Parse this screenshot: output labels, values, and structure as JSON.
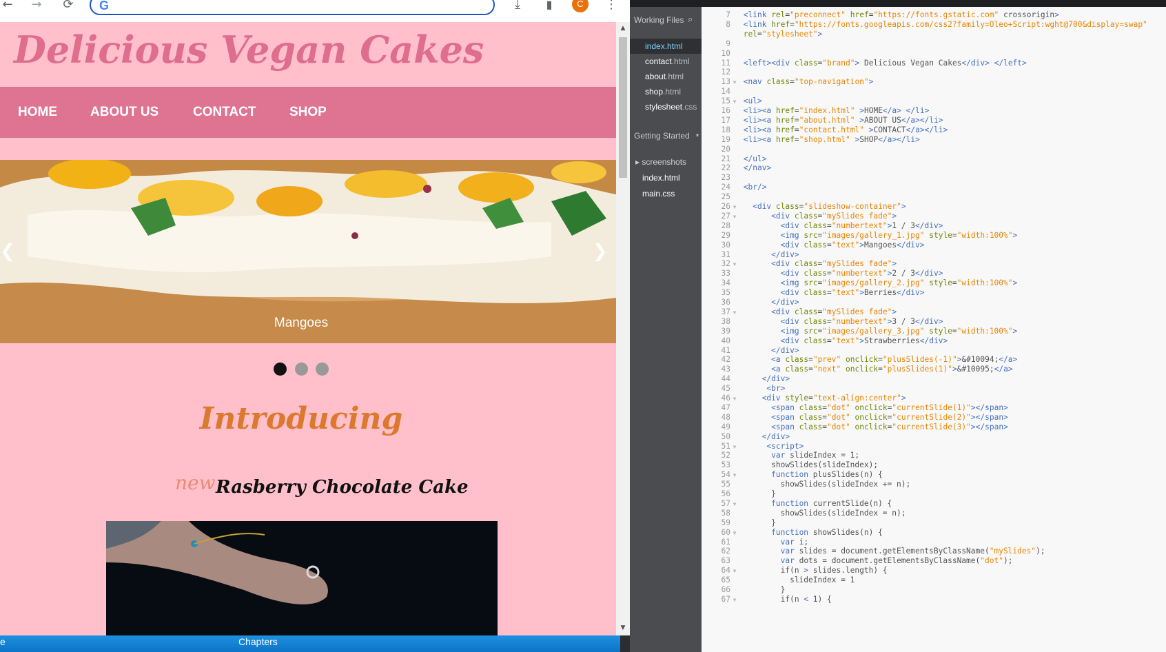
{
  "browser": {
    "toolbar": {
      "back": "←",
      "forward": "→",
      "reload": "⟳",
      "download": "⤓",
      "side_panel": "▮",
      "avatar_letter": "C",
      "menu": "⋮",
      "search_logo": "G"
    },
    "site": {
      "brand": "Delicious Vegan Cakes",
      "nav": [
        "HOME",
        "ABOUT US",
        "CONTACT",
        "SHOP"
      ],
      "slideshow": {
        "caption": "Mangoes",
        "prev": "❮",
        "next": "❯",
        "dots_count": 3,
        "active_dot": 1
      },
      "intro_heading": "Introducing",
      "new_tag": "new",
      "product_name": "Rasberry Chocolate Cake"
    },
    "colors": {
      "page_bg": "#ffc0cb",
      "nav_bg": "#df7392",
      "brand": "#df6d8e",
      "intro": "#db7a2f"
    }
  },
  "taskbar": {
    "left_text": "e",
    "chapters": "Chapters"
  },
  "editor": {
    "sidebar": {
      "working_files_label": "Working Files",
      "working_files": [
        {
          "name": "index",
          "ext": ".html",
          "selected": true
        },
        {
          "name": "contact",
          "ext": ".html",
          "selected": false
        },
        {
          "name": "about",
          "ext": ".html",
          "selected": false
        },
        {
          "name": "shop",
          "ext": ".html",
          "selected": false
        },
        {
          "name": "stylesheet",
          "ext": ".css",
          "selected": false
        }
      ],
      "project_label": "Getting Started",
      "project_items": [
        {
          "name": "screenshots",
          "folder": true
        },
        {
          "name": "index.html",
          "folder": false
        },
        {
          "name": "main.css",
          "folder": false
        }
      ]
    },
    "code_lines": [
      {
        "n": "7",
        "f": "",
        "t": "<link rel=\"preconnect\" href=\"https://fonts.gstatic.com\" crossorigin>"
      },
      {
        "n": "8",
        "f": "",
        "t": "<link href=\"https://fonts.googleapis.com/css2?family=Oleo+Script:wght@700&display=swap\""
      },
      {
        "n": "",
        "f": "",
        "t": "rel=\"stylesheet\">"
      },
      {
        "n": "9",
        "f": "",
        "t": ""
      },
      {
        "n": "10",
        "f": "",
        "t": ""
      },
      {
        "n": "11",
        "f": "",
        "t": "<left><div class=\"brand\"> Delicious Vegan Cakes</div> </left>"
      },
      {
        "n": "12",
        "f": "",
        "t": ""
      },
      {
        "n": "13",
        "f": "▼",
        "t": "<nav class=\"top-navigation\">"
      },
      {
        "n": "14",
        "f": "",
        "t": ""
      },
      {
        "n": "15",
        "f": "▼",
        "t": "<ul>"
      },
      {
        "n": "16",
        "f": "",
        "t": "<li><a href=\"index.html\" >HOME</a> </li>"
      },
      {
        "n": "17",
        "f": "",
        "t": "<li><a href=\"about.html\" >ABOUT US</a></li>"
      },
      {
        "n": "18",
        "f": "",
        "t": "<li><a href=\"contact.html\" >CONTACT</a></li>"
      },
      {
        "n": "19",
        "f": "",
        "t": "<li><a href=\"shop.html\" >SHOP</a></li>"
      },
      {
        "n": "20",
        "f": "",
        "t": ""
      },
      {
        "n": "21",
        "f": "",
        "t": "</ul>"
      },
      {
        "n": "22",
        "f": "",
        "t": "</nav>"
      },
      {
        "n": "23",
        "f": "",
        "t": ""
      },
      {
        "n": "24",
        "f": "",
        "t": "<br/>"
      },
      {
        "n": "25",
        "f": "",
        "t": ""
      },
      {
        "n": "26",
        "f": "▼",
        "t": "  <div class=\"slideshow-container\">"
      },
      {
        "n": "27",
        "f": "▼",
        "t": "      <div class=\"mySlides fade\">"
      },
      {
        "n": "28",
        "f": "",
        "t": "        <div class=\"numbertext\">1 / 3</div>"
      },
      {
        "n": "29",
        "f": "",
        "t": "        <img src=\"images/gallery_1.jpg\" style=\"width:100%\">"
      },
      {
        "n": "30",
        "f": "",
        "t": "        <div class=\"text\">Mangoes</div>"
      },
      {
        "n": "31",
        "f": "",
        "t": "      </div>"
      },
      {
        "n": "32",
        "f": "▼",
        "t": "      <div class=\"mySlides fade\">"
      },
      {
        "n": "33",
        "f": "",
        "t": "        <div class=\"numbertext\">2 / 3</div>"
      },
      {
        "n": "34",
        "f": "",
        "t": "        <img src=\"images/gallery_2.jpg\" style=\"width:100%\">"
      },
      {
        "n": "35",
        "f": "",
        "t": "        <div class=\"text\">Berries</div>"
      },
      {
        "n": "36",
        "f": "",
        "t": "      </div>"
      },
      {
        "n": "37",
        "f": "▼",
        "t": "      <div class=\"mySlides fade\">"
      },
      {
        "n": "38",
        "f": "",
        "t": "        <div class=\"numbertext\">3 / 3</div>"
      },
      {
        "n": "39",
        "f": "",
        "t": "        <img src=\"images/gallery_3.jpg\" style=\"width:100%\">"
      },
      {
        "n": "40",
        "f": "",
        "t": "        <div class=\"text\">Strawberries</div>"
      },
      {
        "n": "41",
        "f": "",
        "t": "      </div>"
      },
      {
        "n": "42",
        "f": "",
        "t": "      <a class=\"prev\" onclick=\"plusSlides(-1)\">&#10094;</a>"
      },
      {
        "n": "43",
        "f": "",
        "t": "      <a class=\"next\" onclick=\"plusSlides(1)\">&#10095;</a>"
      },
      {
        "n": "44",
        "f": "",
        "t": "    </div>"
      },
      {
        "n": "45",
        "f": "",
        "t": "     <br>"
      },
      {
        "n": "46",
        "f": "▼",
        "t": "    <div style=\"text-align:center\">"
      },
      {
        "n": "47",
        "f": "",
        "t": "      <span class=\"dot\" onclick=\"currentSlide(1)\"></span>"
      },
      {
        "n": "48",
        "f": "",
        "t": "      <span class=\"dot\" onclick=\"currentSlide(2)\"></span>"
      },
      {
        "n": "49",
        "f": "",
        "t": "      <span class=\"dot\" onclick=\"currentSlide(3)\"></span>"
      },
      {
        "n": "50",
        "f": "",
        "t": "    </div>"
      },
      {
        "n": "51",
        "f": "▼",
        "t": "     <script>"
      },
      {
        "n": "52",
        "f": "",
        "t": "      var slideIndex = 1;"
      },
      {
        "n": "53",
        "f": "",
        "t": "      showSlides(slideIndex);"
      },
      {
        "n": "54",
        "f": "▼",
        "t": "      function plusSlides(n) {"
      },
      {
        "n": "55",
        "f": "",
        "t": "        showSlides(slideIndex += n);"
      },
      {
        "n": "56",
        "f": "",
        "t": "      }"
      },
      {
        "n": "57",
        "f": "▼",
        "t": "      function currentSlide(n) {"
      },
      {
        "n": "58",
        "f": "",
        "t": "        showSlides(slideIndex = n);"
      },
      {
        "n": "59",
        "f": "",
        "t": "      }"
      },
      {
        "n": "60",
        "f": "▼",
        "t": "      function showSlides(n) {"
      },
      {
        "n": "61",
        "f": "",
        "t": "        var i;"
      },
      {
        "n": "62",
        "f": "",
        "t": "        var slides = document.getElementsByClassName(\"mySlides\");"
      },
      {
        "n": "63",
        "f": "",
        "t": "        var dots = document.getElementsByClassName(\"dot\");"
      },
      {
        "n": "64",
        "f": "▼",
        "t": "        if(n > slides.length) {"
      },
      {
        "n": "65",
        "f": "",
        "t": "          slideIndex = 1"
      },
      {
        "n": "66",
        "f": "",
        "t": "        }"
      },
      {
        "n": "67",
        "f": "▼",
        "t": "        if(n < 1) {"
      }
    ]
  }
}
